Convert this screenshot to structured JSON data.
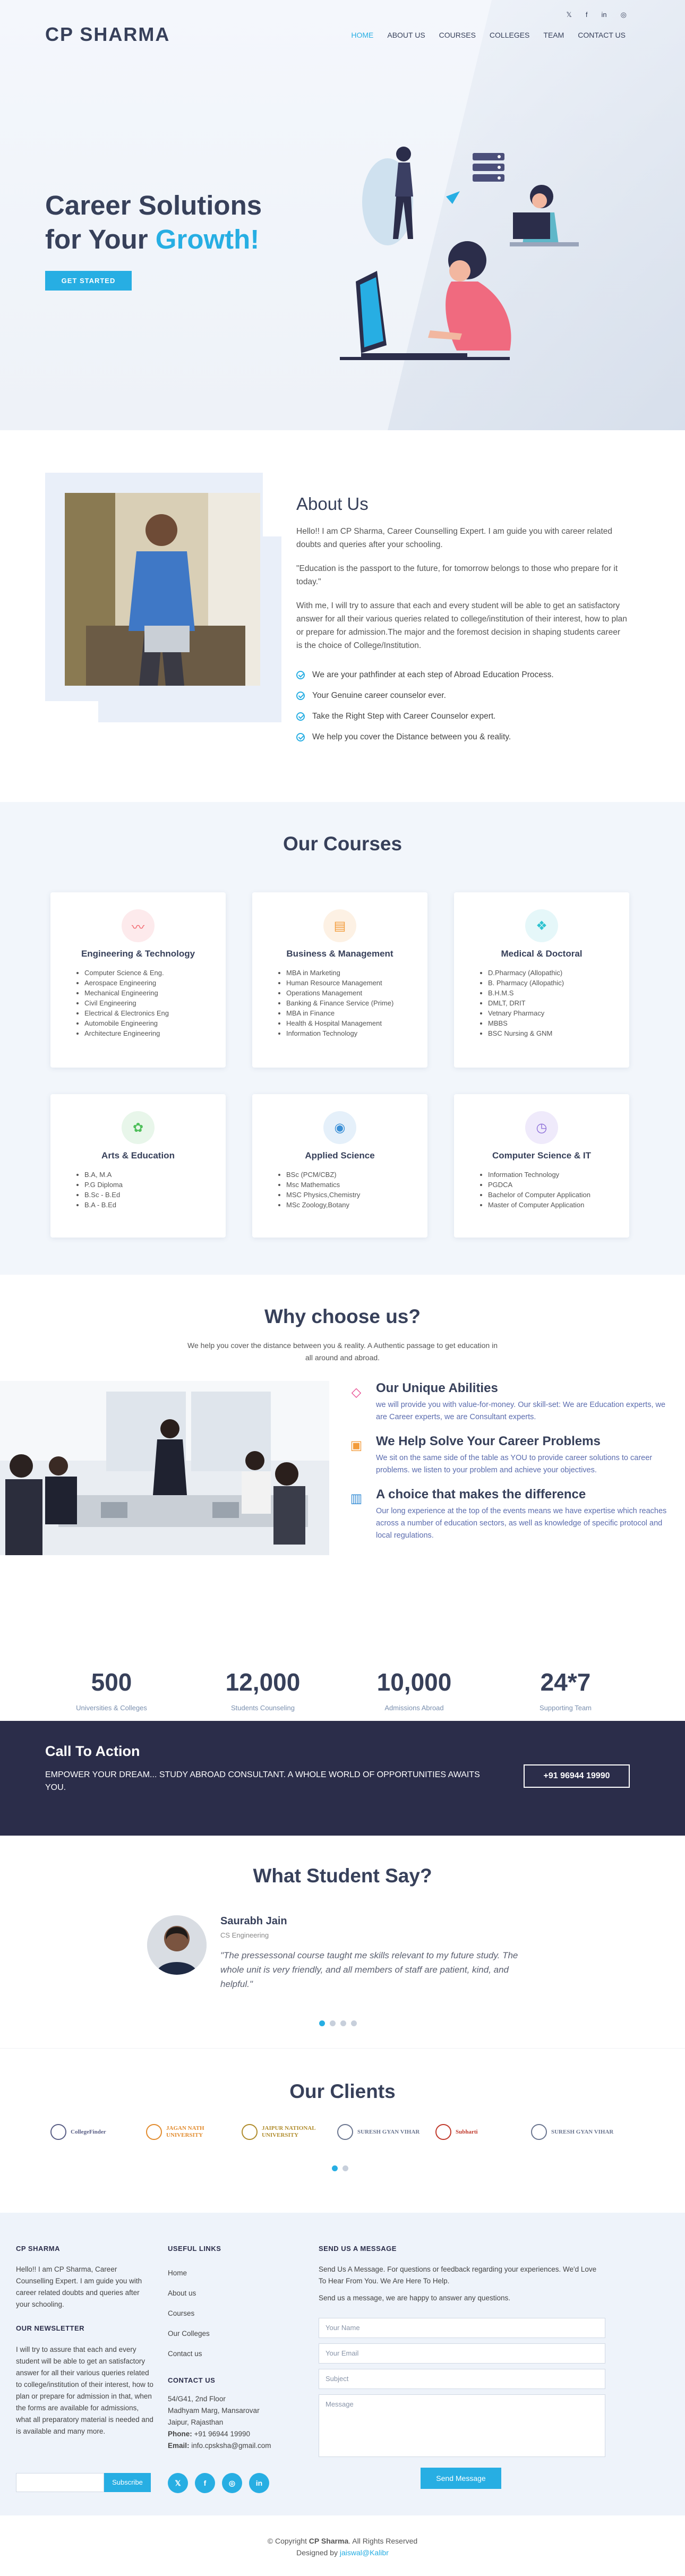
{
  "header": {
    "logo": "CP SHARMA",
    "social": [
      "𝕏",
      "f",
      "in",
      "◎"
    ],
    "nav": [
      "HOME",
      "ABOUT US",
      "COURSES",
      "COLLEGES",
      "TEAM",
      "CONTACT US"
    ]
  },
  "hero": {
    "title_line1": "Career Solutions",
    "title_line2_prefix": "for Your ",
    "title_line2_accent": "Growth!",
    "button": "GET STARTED"
  },
  "about": {
    "title": "About Us",
    "intro": "Hello!! I am CP Sharma, Career Counselling Expert. I am guide you with career related doubts and queries after your schooling.",
    "quote": "\"Education is the passport to the future, for tomorrow belongs to those who prepare for it today.\"",
    "body": "With me, I will try to assure that each and every student will be able to get an satisfactory answer for all their various queries related to college/institution of their interest, how to plan or prepare for admission.The major and the foremost decision in shaping students career is the choice of College/Institution.",
    "points": [
      "We are your pathfinder at each step of Abroad Education Process.",
      "Your Genuine career counselor ever.",
      "Take the Right Step with Career Counselor expert.",
      "We help you cover the Distance between you & reality."
    ]
  },
  "courses": {
    "title": "Our Courses",
    "cards": [
      {
        "icon": "〰",
        "color": "#f3646b",
        "bg": "#fdeaec",
        "title": "Engineering & Technology",
        "items": [
          "Computer Science & Eng.",
          "Aerospace Engineering",
          "Mechanical Engineering",
          "Civil Engineering",
          "Electrical & Electronics Eng",
          "Automobile Engineering",
          "Architecture Engineering"
        ]
      },
      {
        "icon": "▤",
        "color": "#f39c3c",
        "bg": "#fdf1e4",
        "title": "Business & Management",
        "items": [
          "MBA in Marketing",
          "Human Resource Management",
          "Operations Management",
          "Banking & Finance Service (Prime)",
          "MBA in Finance",
          "Health & Hospital Management",
          "Information Technology"
        ]
      },
      {
        "icon": "❖",
        "color": "#2fc3d0",
        "bg": "#e5f7f9",
        "title": "Medical & Doctoral",
        "items": [
          "D.Pharmacy (Allopathic)",
          "B. Pharmacy (Allopathic)",
          "B.H.M.S",
          "DMLT, DRIT",
          "Vetnary Pharmacy",
          "MBBS",
          "BSC Nursing & GNM"
        ]
      },
      {
        "icon": "✿",
        "color": "#4fbf5b",
        "bg": "#e8f6ea",
        "title": "Arts & Education",
        "items": [
          "B.A, M.A",
          "P.G Diploma",
          "B.Sc - B.Ed",
          "B.A - B.Ed"
        ]
      },
      {
        "icon": "◉",
        "color": "#3a8fd6",
        "bg": "#e5f0fa",
        "title": "Applied Science",
        "items": [
          "BSc (PCM/CBZ)",
          "Msc Mathematics",
          "MSC Physics,Chemistry",
          "MSc Zoology,Botany"
        ]
      },
      {
        "icon": "◷",
        "color": "#8c6ed8",
        "bg": "#efeafb",
        "title": "Computer Science & IT",
        "items": [
          "Information Technology",
          "PGDCA",
          "Bachelor of Computer Application",
          "Master of Computer Application"
        ]
      }
    ]
  },
  "why": {
    "title": "Why choose us?",
    "subtitle_l1": "We help you cover the distance between you & reality. A Authentic passage to get education in",
    "subtitle_l2": "all around and abroad.",
    "features": [
      {
        "icon": "diamond-icon",
        "glyph": "◇",
        "color": "#e8478e",
        "title": "Our Unique Abilities",
        "text": "we will provide you with value-for-money. Our skill-set: We are Education experts, we are Career experts, we are Consultant experts."
      },
      {
        "icon": "briefcase-icon",
        "glyph": "▣",
        "color": "#f39c3c",
        "title": "We Help Solve Your Career Problems",
        "text": "We sit on the same side of the table as YOU to provide career solutions to career problems. we listen to your problem and achieve your objectives."
      },
      {
        "icon": "book-icon",
        "glyph": "▥",
        "color": "#3a8fd6",
        "title": "A choice that makes the difference",
        "text": "Our long experience at the top of the events means we have expertise which reaches across a number of education sectors, as well as knowledge of specific protocol and local regulations."
      }
    ],
    "stats": [
      {
        "value": "500",
        "label": "Universities & Colleges"
      },
      {
        "value": "12,000",
        "label": "Students Counseling"
      },
      {
        "value": "10,000",
        "label": "Admissions Abroad"
      },
      {
        "value": "24*7",
        "label": "Supporting Team"
      }
    ]
  },
  "cta": {
    "title": "Call To Action",
    "text": "EMPOWER YOUR DREAM... STUDY ABROAD CONSULTANT. A WHOLE WORLD OF OPPORTUNITIES AWAITS YOU.",
    "phone": "+91 96944 19990"
  },
  "testimonials": {
    "title": "What Student Say?",
    "name": "Saurabh Jain",
    "role": "CS Engineering",
    "quote": "\"The pressessonal course taught me skills relevant to my future study. The whole unit is very friendly, and all members of staff are patient, kind, and helpful.\""
  },
  "clients": {
    "title": "Our Clients",
    "logos": [
      {
        "name": "CollegeFinder",
        "color": "#5a5f86"
      },
      {
        "name": "JAGAN NATH UNIVERSITY",
        "color": "#e28b2d"
      },
      {
        "name": "JAIPUR NATIONAL UNIVERSITY",
        "color": "#b08c2c"
      },
      {
        "name": "SURESH GYAN VIHAR",
        "color": "#6b7690"
      },
      {
        "name": "Subharti",
        "color": "#c0392b"
      },
      {
        "name": "SURESH GYAN VIHAR",
        "color": "#6b7690"
      }
    ]
  },
  "footer": {
    "col1_title": "CP SHARMA",
    "col1_text": "Hello!! I am CP Sharma, Career Counselling Expert. I am guide you with career related doubts and queries after your schooling.",
    "newsletter_title": "OUR NEWSLETTER",
    "newsletter_text": "I will try to assure that each and every student will be able to get an satisfactory answer for all their various queries related to college/institution of their interest, how to plan or prepare for admission in that, when the forms are available for admissions, what all preparatory material is needed and is available and many more.",
    "subscribe": "Subscribe",
    "links_title": "USEFUL LINKS",
    "links": [
      "Home",
      "About us",
      "Courses",
      "Our Colleges",
      "Contact us"
    ],
    "contact_title": "CONTACT US",
    "address": [
      "54/G41, 2nd Floor",
      "Madhyam Marg, Mansarovar",
      "Jaipur, Rajasthan"
    ],
    "phone_label": "Phone:",
    "phone": " +91 96944 19990",
    "email_label": "Email:",
    "email": " info.cpsksha@gmail.com",
    "msg_title": "SEND US A MESSAGE",
    "msg_text": "Send Us A Message. For questions or feedback regarding your experiences. We'd Love To Hear From You. We Are Here To Help.",
    "msg_text2": "Send us a message, we are happy to answer any questions.",
    "placeholders": {
      "name": "Your Name",
      "email": "Your Email",
      "subject": "Subject",
      "message": "Message"
    },
    "send": "Send Message",
    "social": [
      "𝕏",
      "f",
      "◎",
      "in"
    ]
  },
  "copyright": {
    "prefix": "© Copyright ",
    "brand": "CP Sharma",
    "suffix": ". All Rights Reserved",
    "designed_prefix": "Designed by ",
    "designer": "jaiswal@Kalibr"
  }
}
